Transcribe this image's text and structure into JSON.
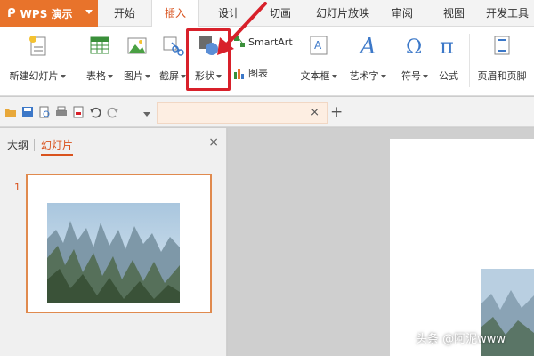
{
  "menu": {
    "app_name": "WPS 演示",
    "tabs": [
      "开始",
      "插入",
      "设计",
      "切画",
      "幻灯片放映",
      "审阅",
      "视图",
      "开发工具"
    ],
    "active_tab": "插入"
  },
  "ribbon": {
    "new_slide": "新建幻灯片",
    "table": "表格",
    "picture": "图片",
    "screenshot": "截屏",
    "shape": "形状",
    "smartart": "SmartArt",
    "chart": "图表",
    "textbox": "文本框",
    "wordart": "艺术字",
    "symbol": "符号",
    "formula": "公式",
    "header_footer": "页眉和页脚"
  },
  "quickbar": {
    "doc_tab_close": "×",
    "new_tab": "+"
  },
  "panel": {
    "outline_tab": "大纲",
    "slides_tab": "幻灯片",
    "close": "×",
    "slide_number": "1"
  },
  "watermark": "头条 @阿泥www",
  "colors": {
    "accent": "#e8732b",
    "highlight": "#d8202a",
    "active_tab_text": "#d9531e"
  }
}
